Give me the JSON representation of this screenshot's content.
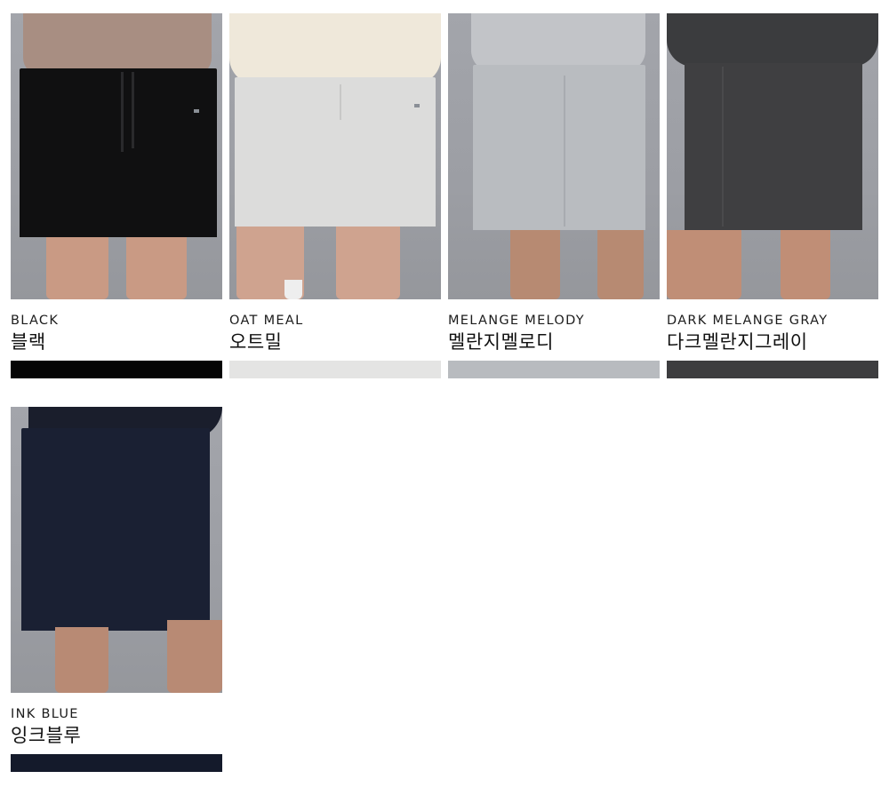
{
  "colors": [
    {
      "name_en": "BLACK",
      "name_kr": "블랙",
      "swatch": "#050505",
      "garment": "#101011",
      "top": "#a88e82"
    },
    {
      "name_en": "OAT MEAL",
      "name_kr": "오트밀",
      "swatch": "#e4e4e3",
      "garment": "#dcdcdb",
      "top": "#efe8da"
    },
    {
      "name_en": "MELANGE MELODY",
      "name_kr": "멜란지멜로디",
      "swatch": "#b8bbbf",
      "garment": "#b9bcc0",
      "top": "#c2c4c8"
    },
    {
      "name_en": "DARK MELANGE GRAY",
      "name_kr": "다크멜란지그레이",
      "swatch": "#3d3d3f",
      "garment": "#3f3f41",
      "top": "#3b3c3e"
    },
    {
      "name_en": "INK BLUE",
      "name_kr": "잉크블루",
      "swatch": "#141a2b",
      "garment": "#1a2033",
      "top": "#1a1e2c"
    }
  ]
}
